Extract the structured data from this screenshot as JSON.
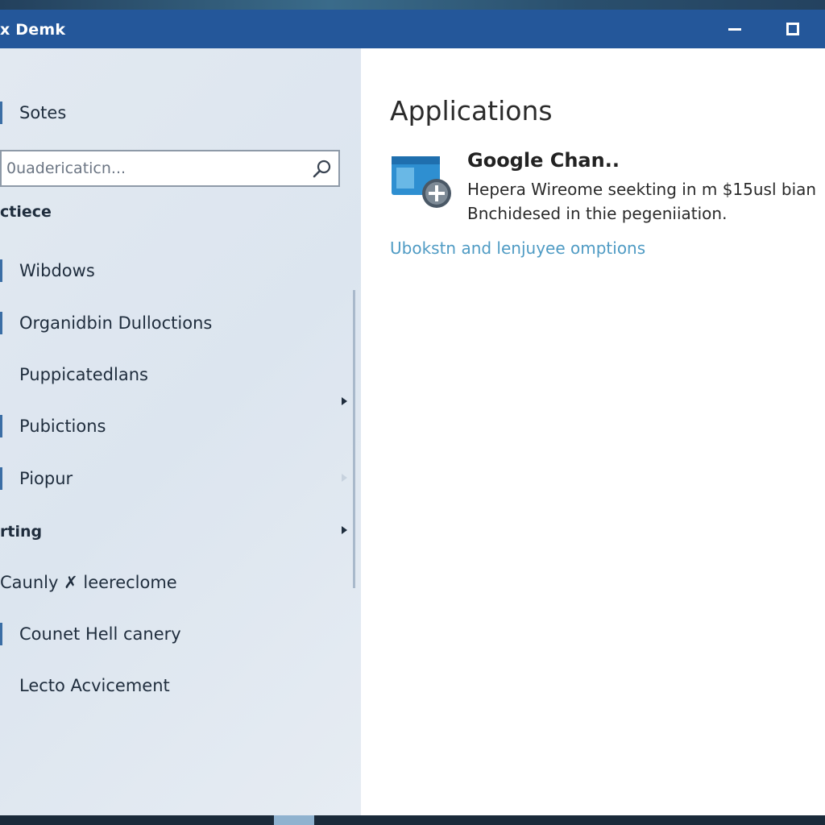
{
  "window": {
    "title": "x Demk",
    "minimize_icon": "minimize-icon",
    "maximize_icon": "maximize-icon"
  },
  "sidebar": {
    "top_item": {
      "label": "Sotes"
    },
    "search": {
      "placeholder": "0uadericaticn...",
      "icon": "search-icon"
    },
    "sections": [
      {
        "header": "ctiece",
        "items": [
          {
            "label": "Wibdows"
          },
          {
            "label": "Organidbin Dulloctions"
          },
          {
            "label": "Puppicatedlans"
          },
          {
            "label": "Pubictions"
          },
          {
            "label": "Piopur"
          }
        ]
      },
      {
        "header": "rting",
        "items": [
          {
            "label": "Caunly ✗ leereclome"
          },
          {
            "label": "Counet Hell canery"
          },
          {
            "label": "Lecto Acvicement"
          }
        ]
      }
    ]
  },
  "content": {
    "title": "Applications",
    "app": {
      "icon": "app-add-icon",
      "name": "Google  Chan..",
      "description": "Hepera Wireome seekting in m $15usl bian Bnchidesed in thie pegeniiation."
    },
    "link": "Ubokstn and lenjuyee omptions"
  },
  "colors": {
    "titlebar": "#24579a",
    "sidebar_bg": "#dfe7f0",
    "link": "#4f9bc4",
    "app_icon_blue": "#2e8fd1"
  }
}
